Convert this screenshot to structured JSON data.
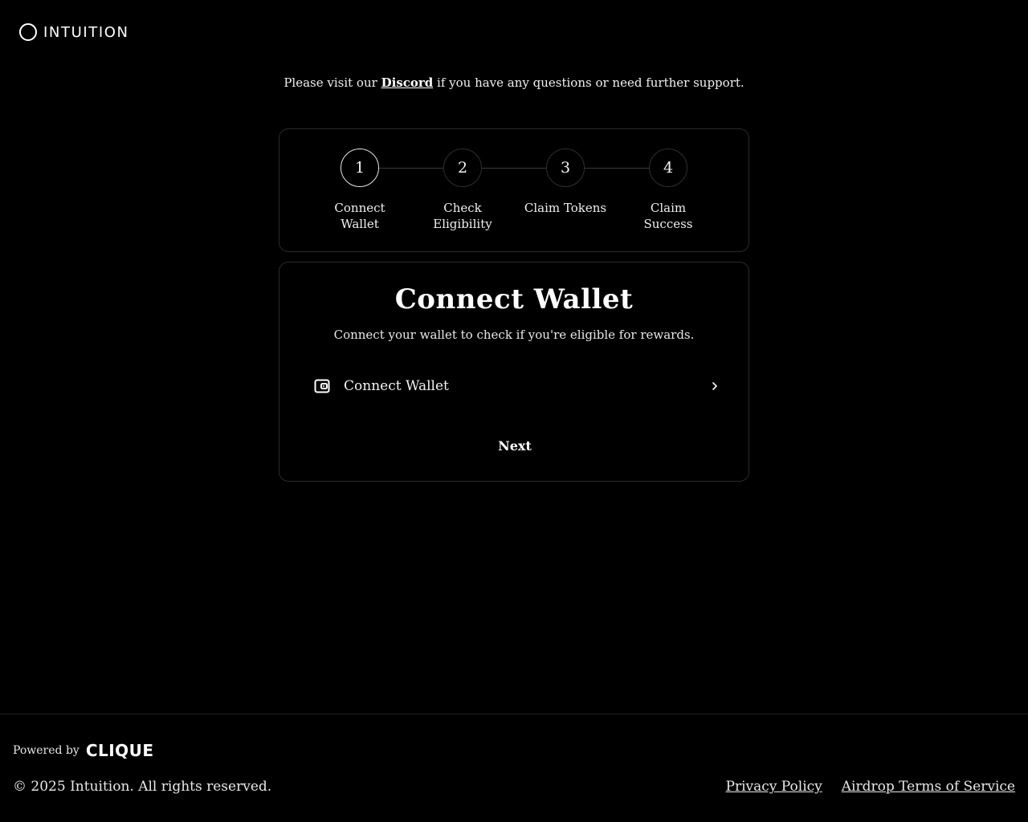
{
  "header": {
    "logo_icon": "ring-logo-icon",
    "logo_text": "INTUITION"
  },
  "support": {
    "prefix": "Please visit our ",
    "link_text": "Discord",
    "suffix": " if you have any questions or need further support."
  },
  "stepper": {
    "active_step": 1,
    "steps": [
      {
        "number": "1",
        "label": "Connect Wallet"
      },
      {
        "number": "2",
        "label": "Check Eligibility"
      },
      {
        "number": "3",
        "label": "Claim Tokens"
      },
      {
        "number": "4",
        "label": "Claim Success"
      }
    ]
  },
  "main": {
    "title": "Connect Wallet",
    "subtitle": "Connect your wallet to check if you're eligible for rewards.",
    "connect_label": "Connect Wallet",
    "connect_icon": "wallet-icon",
    "chevron_icon": "chevron-right-icon",
    "next_label": "Next"
  },
  "footer": {
    "powered_by": "Powered by",
    "brand": "CLIQUE",
    "copyright": "© 2025 Intuition. All rights reserved.",
    "links": [
      "Privacy Policy",
      "Airdrop Terms of Service"
    ]
  },
  "colors": {
    "background": "#000000",
    "text": "#f2f2f2",
    "border": "#2a2a2a"
  }
}
